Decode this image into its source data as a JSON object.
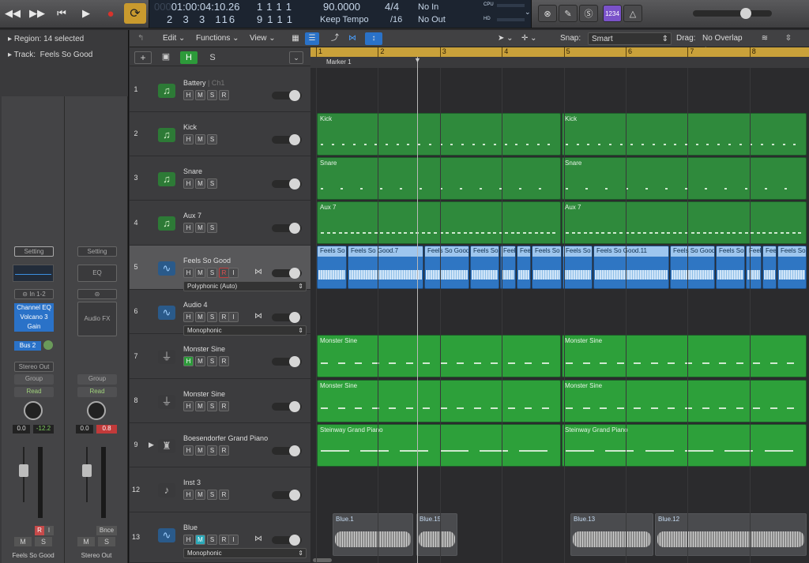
{
  "transport": {
    "rewind_icon": "rewind-icon",
    "forward_icon": "fast-forward-icon",
    "tostart_icon": "go-to-start-icon",
    "play_icon": "play-icon",
    "record_icon": "record-icon",
    "cycle_icon": "cycle-icon"
  },
  "lcd": {
    "smpte": "01:00:04:10.26",
    "smpte_dim": "000",
    "bar_top": [
      "1",
      "1",
      "1",
      "1"
    ],
    "bar_bottom": [
      "2",
      "3",
      "3",
      "116"
    ],
    "bar2_top": [
      "1",
      "1",
      "1",
      "1"
    ],
    "bar2_bottom": [
      "9",
      "1",
      "1",
      "1"
    ],
    "tempo": "90.0000",
    "tempo_mode": "Keep Tempo",
    "sig_top": "4/4",
    "sig_bottom": "/16",
    "in_label": "No In",
    "out_label": "No Out",
    "cpu_label": "CPU",
    "hd_label": "HD"
  },
  "tools": {
    "count_in": "1234"
  },
  "inspector": {
    "region_label": "Region:",
    "region_value": "14 selected",
    "track_label": "Track:",
    "track_value": "Feels So Good"
  },
  "strip1": {
    "setting": "Setting",
    "input": "In 1-2",
    "plugins": [
      "Channel EQ",
      "Volcano 3",
      "Gain"
    ],
    "send": "Bus 2",
    "output": "Stereo Out",
    "group": "Group",
    "automation": "Read",
    "vol": "0.0",
    "peak": "-12.2",
    "r": "R",
    "i": "I",
    "m": "M",
    "s": "S",
    "name": "Feels So Good"
  },
  "strip2": {
    "setting": "Setting",
    "eq": "EQ",
    "audio_fx": "Audio FX",
    "group": "Group",
    "automation": "Read",
    "vol": "0.0",
    "peak": "0.8",
    "bounce": "Bnce",
    "m": "M",
    "s": "S",
    "name": "Stereo Out"
  },
  "menubar": {
    "edit": "Edit",
    "functions": "Functions",
    "view": "View",
    "snap_label": "Snap:",
    "snap_value": "Smart",
    "drag_label": "Drag:",
    "drag_value": "No Overlap"
  },
  "track_global": {
    "h": "H",
    "s": "S"
  },
  "ruler": {
    "bars": [
      "1",
      "2",
      "3",
      "4",
      "5",
      "6",
      "7",
      "8"
    ],
    "marker": "Marker 1"
  },
  "tracks": [
    {
      "num": "1",
      "name": "Battery",
      "sub": "| Ch1",
      "type": "drummer",
      "buttons": [
        "H",
        "M",
        "S",
        "R"
      ]
    },
    {
      "num": "2",
      "name": "Kick",
      "type": "drummer",
      "buttons": [
        "H",
        "M",
        "S"
      ]
    },
    {
      "num": "3",
      "name": "Snare",
      "type": "drummer",
      "buttons": [
        "H",
        "M",
        "S"
      ]
    },
    {
      "num": "4",
      "name": "Aux 7",
      "type": "drummer",
      "buttons": [
        "H",
        "M",
        "S"
      ]
    },
    {
      "num": "5",
      "name": "Feels So Good",
      "type": "audio",
      "buttons": [
        "H",
        "M",
        "S",
        "R",
        "I"
      ],
      "mode": "Polyphonic (Auto)"
    },
    {
      "num": "6",
      "name": "Audio 4",
      "type": "audio",
      "buttons": [
        "H",
        "M",
        "S",
        "R",
        "I"
      ],
      "mode": "Monophonic"
    },
    {
      "num": "7",
      "name": "Monster Sine",
      "type": "synth",
      "buttons": [
        "H",
        "M",
        "S",
        "R"
      ]
    },
    {
      "num": "8",
      "name": "Monster Sine",
      "type": "synth",
      "buttons": [
        "H",
        "M",
        "S",
        "R"
      ]
    },
    {
      "num": "9",
      "name": "Boesendorfer Grand Piano",
      "type": "piano",
      "buttons": [
        "H",
        "M",
        "S",
        "R"
      ]
    },
    {
      "num": "12",
      "name": "Inst 3",
      "type": "violin",
      "buttons": [
        "H",
        "M",
        "S",
        "R"
      ]
    },
    {
      "num": "13",
      "name": "Blue",
      "type": "audio",
      "buttons": [
        "H",
        "M",
        "S",
        "R",
        "I"
      ],
      "mode": "Monophonic"
    }
  ],
  "regions": {
    "kick": [
      "Kick",
      "Kick"
    ],
    "snare": [
      "Snare",
      "Snare"
    ],
    "aux": [
      "Aux 7",
      "Aux 7"
    ],
    "feels": [
      "Feels So",
      "Feels So Good.7",
      "Feels So Good",
      "Feels So",
      "Feel",
      "Feel",
      "Feels So",
      "Feels So",
      "Feels So Good.11",
      "Feels So Good",
      "Feels So",
      "Feel",
      "Feel",
      "Feels So"
    ],
    "sine1": [
      "Monster Sine",
      "Monster Sine"
    ],
    "sine2": [
      "Monster Sine",
      "Monster Sine"
    ],
    "piano": [
      "Steinway Grand Piano",
      "Steinway Grand Piano"
    ],
    "blue": [
      "Blue.1",
      "Blue.15",
      "Blue.13",
      "Blue.12"
    ]
  },
  "colors": {
    "drummer_region": "#2f8a3c",
    "sine_region": "#2da03a",
    "audio_region": "#2f76c3",
    "ruler": "#c9a13a",
    "cycle": "#c99a2e",
    "record": "#d8332c"
  }
}
